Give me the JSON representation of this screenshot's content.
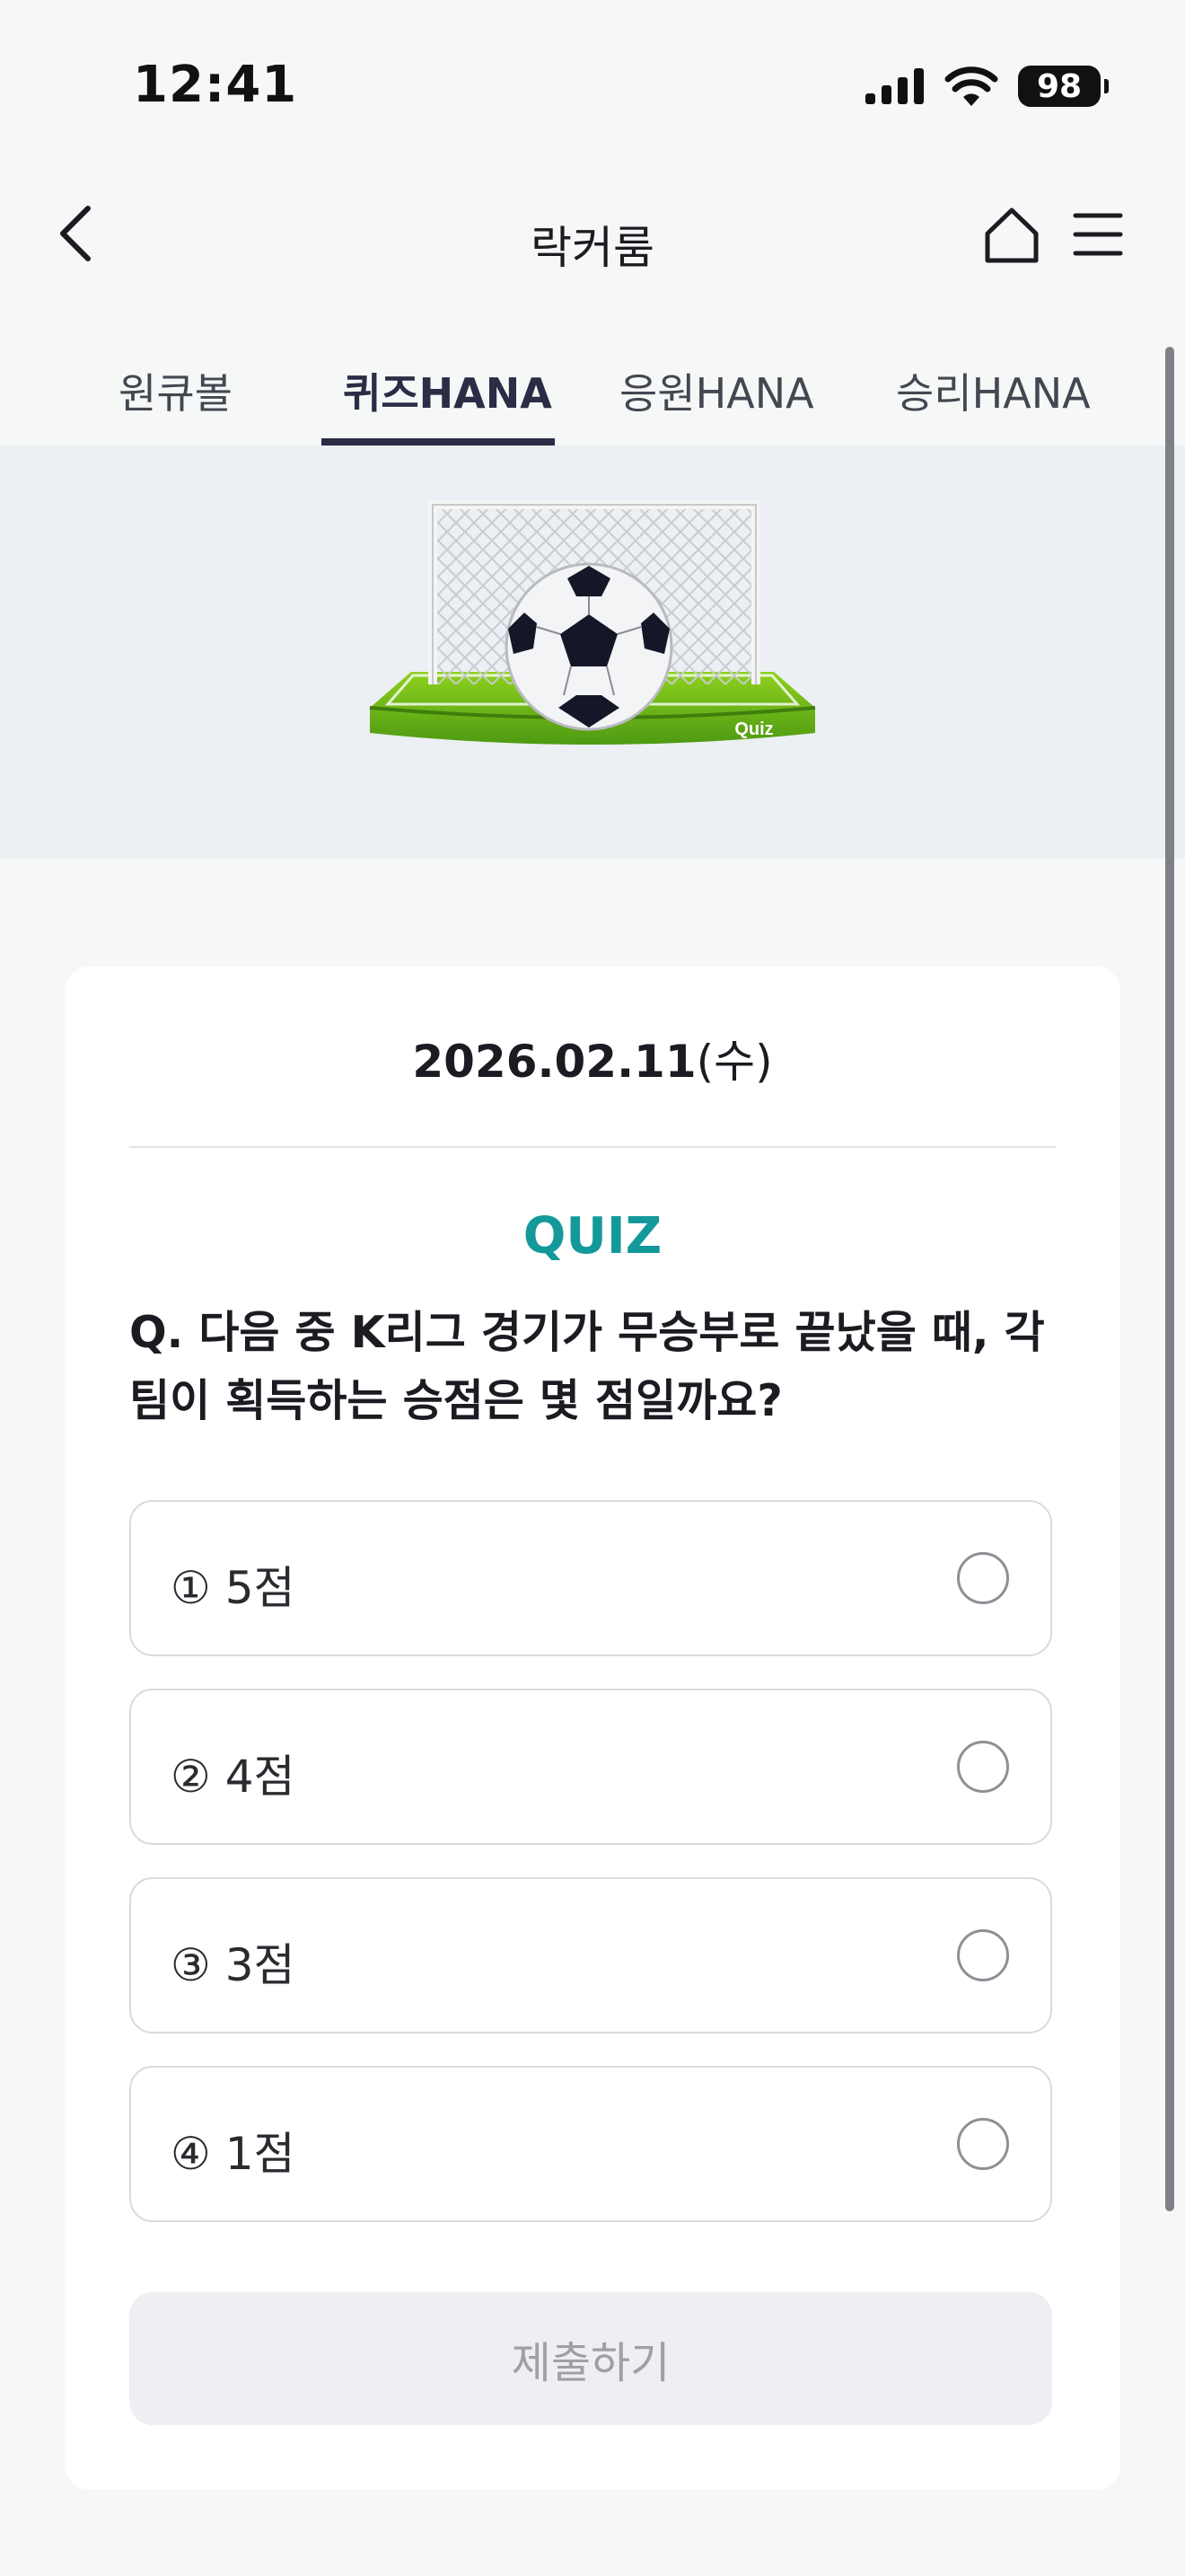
{
  "status_bar": {
    "time": "12:41",
    "battery": "98",
    "icons": [
      "cellular-signal-icon",
      "wifi-icon",
      "battery-icon"
    ]
  },
  "header": {
    "title": "락커룸",
    "icons": [
      "back-chevron-icon",
      "home-icon",
      "hamburger-menu-icon"
    ]
  },
  "tabs": [
    {
      "label": "원큐볼",
      "active": false
    },
    {
      "label": "퀴즈HANA",
      "active": true
    },
    {
      "label": "응원HANA",
      "active": false
    },
    {
      "label": "승리HANA",
      "active": false
    }
  ],
  "hero": {
    "badge_text": "Quiz",
    "illustration": "soccer-ball-goal"
  },
  "quiz": {
    "date": "2026.02.11",
    "day_of_week": "(수)",
    "section_label": "QUIZ",
    "question": "Q. 다음 중 K리그 경기가 무승부로 끝났을 때, 각 팀이 획득하는 승점은 몇 점일까요?",
    "options": [
      {
        "label": "① 5점",
        "selected": false
      },
      {
        "label": "② 4점",
        "selected": false
      },
      {
        "label": "③ 3점",
        "selected": false
      },
      {
        "label": "④ 1점",
        "selected": false
      }
    ],
    "submit_label": "제출하기"
  },
  "colors": {
    "accent_teal": "#14999a",
    "tab_active": "#2a2d45",
    "page_background": "#f6f8f8",
    "hero_background": "#eceff3",
    "submit_disabled_bg": "#eeeff3",
    "submit_disabled_text": "#9ea0a6"
  }
}
